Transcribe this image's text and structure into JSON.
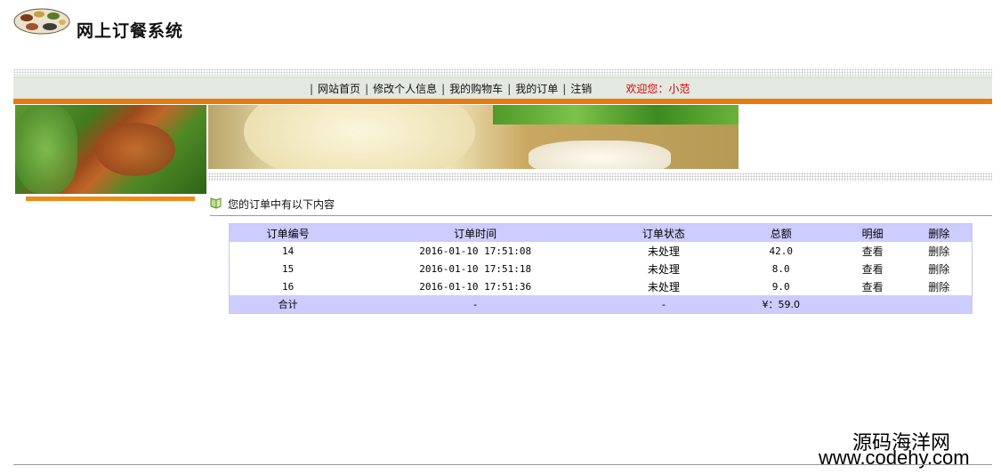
{
  "header": {
    "site_title": "网上订餐系统",
    "logo_icon": "food-plate-logo-icon"
  },
  "nav": {
    "separator": "|",
    "items": [
      {
        "label": "网站首页"
      },
      {
        "label": "修改个人信息"
      },
      {
        "label": "我的购物车"
      },
      {
        "label": "我的订单"
      },
      {
        "label": "注销"
      }
    ],
    "welcome": "欢迎您：小范",
    "colors": {
      "bar": "#e3e9e1",
      "accent": "#e87b0c",
      "welcome": "#d40000"
    }
  },
  "section": {
    "title": "您的订单中有以下内容",
    "icon": "book-icon"
  },
  "table": {
    "headers": [
      "订单编号",
      "订单时间",
      "订单状态",
      "总额",
      "明细",
      "删除"
    ],
    "rows": [
      {
        "id": "14",
        "time": "2016-01-10 17:51:08",
        "status": "未处理",
        "total": "42.0",
        "detail": "查看",
        "delete": "删除"
      },
      {
        "id": "15",
        "time": "2016-01-10 17:51:18",
        "status": "未处理",
        "total": "8.0",
        "detail": "查看",
        "delete": "删除"
      },
      {
        "id": "16",
        "time": "2016-01-10 17:51:36",
        "status": "未处理",
        "total": "9.0",
        "detail": "查看",
        "delete": "删除"
      }
    ],
    "footer": {
      "label": "合计",
      "time": "-",
      "status": "-",
      "total": "¥：59.0"
    },
    "colors": {
      "header_bg": "#ccccff"
    }
  },
  "watermark": {
    "line1": "源码海洋网",
    "line2": "www.codehy.com"
  }
}
